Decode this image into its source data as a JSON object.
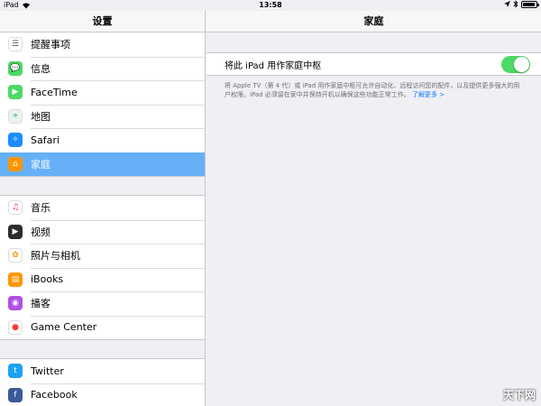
{
  "status_bar": {
    "device": "iPad",
    "time": "13:58",
    "battery_level": 0.9
  },
  "sidebar": {
    "title": "设置",
    "groups": [
      [
        {
          "label": "提醒事项",
          "icon": "reminders-icon",
          "color": "#ffffff"
        },
        {
          "label": "信息",
          "icon": "messages-icon",
          "color": "#4cd964"
        },
        {
          "label": "FaceTime",
          "icon": "facetime-icon",
          "color": "#4cd964"
        },
        {
          "label": "地图",
          "icon": "maps-icon",
          "color": "#e9f3ea"
        },
        {
          "label": "Safari",
          "icon": "safari-icon",
          "color": "#1a8cff"
        },
        {
          "label": "家庭",
          "icon": "home-icon",
          "color": "#ff9500",
          "selected": true
        }
      ],
      [
        {
          "label": "音乐",
          "icon": "music-icon",
          "color": "#ffffff"
        },
        {
          "label": "视频",
          "icon": "videos-icon",
          "color": "#2c2c2e"
        },
        {
          "label": "照片与相机",
          "icon": "photos-icon",
          "color": "#ffffff"
        },
        {
          "label": "iBooks",
          "icon": "ibooks-icon",
          "color": "#ff9500"
        },
        {
          "label": "播客",
          "icon": "podcasts-icon",
          "color": "#b150e2"
        },
        {
          "label": "Game Center",
          "icon": "game-center-icon",
          "color": "#ffffff"
        }
      ],
      [
        {
          "label": "Twitter",
          "icon": "twitter-icon",
          "color": "#1da1f2"
        },
        {
          "label": "Facebook",
          "icon": "facebook-icon",
          "color": "#3b5998"
        }
      ]
    ]
  },
  "detail": {
    "title": "家庭",
    "setting_label": "将此 iPad 用作家庭中枢",
    "toggle_on": true,
    "footer_text": "将 Apple TV（第 4 代）或 iPad 用作家庭中枢可允许自动化、远程访问您的配件，以及提供更多强大的用户权限。iPad 必须留在家中并保持开机以确保这些功能正常工作。",
    "footer_link": "了解更多 >"
  },
  "watermark": "天下网"
}
